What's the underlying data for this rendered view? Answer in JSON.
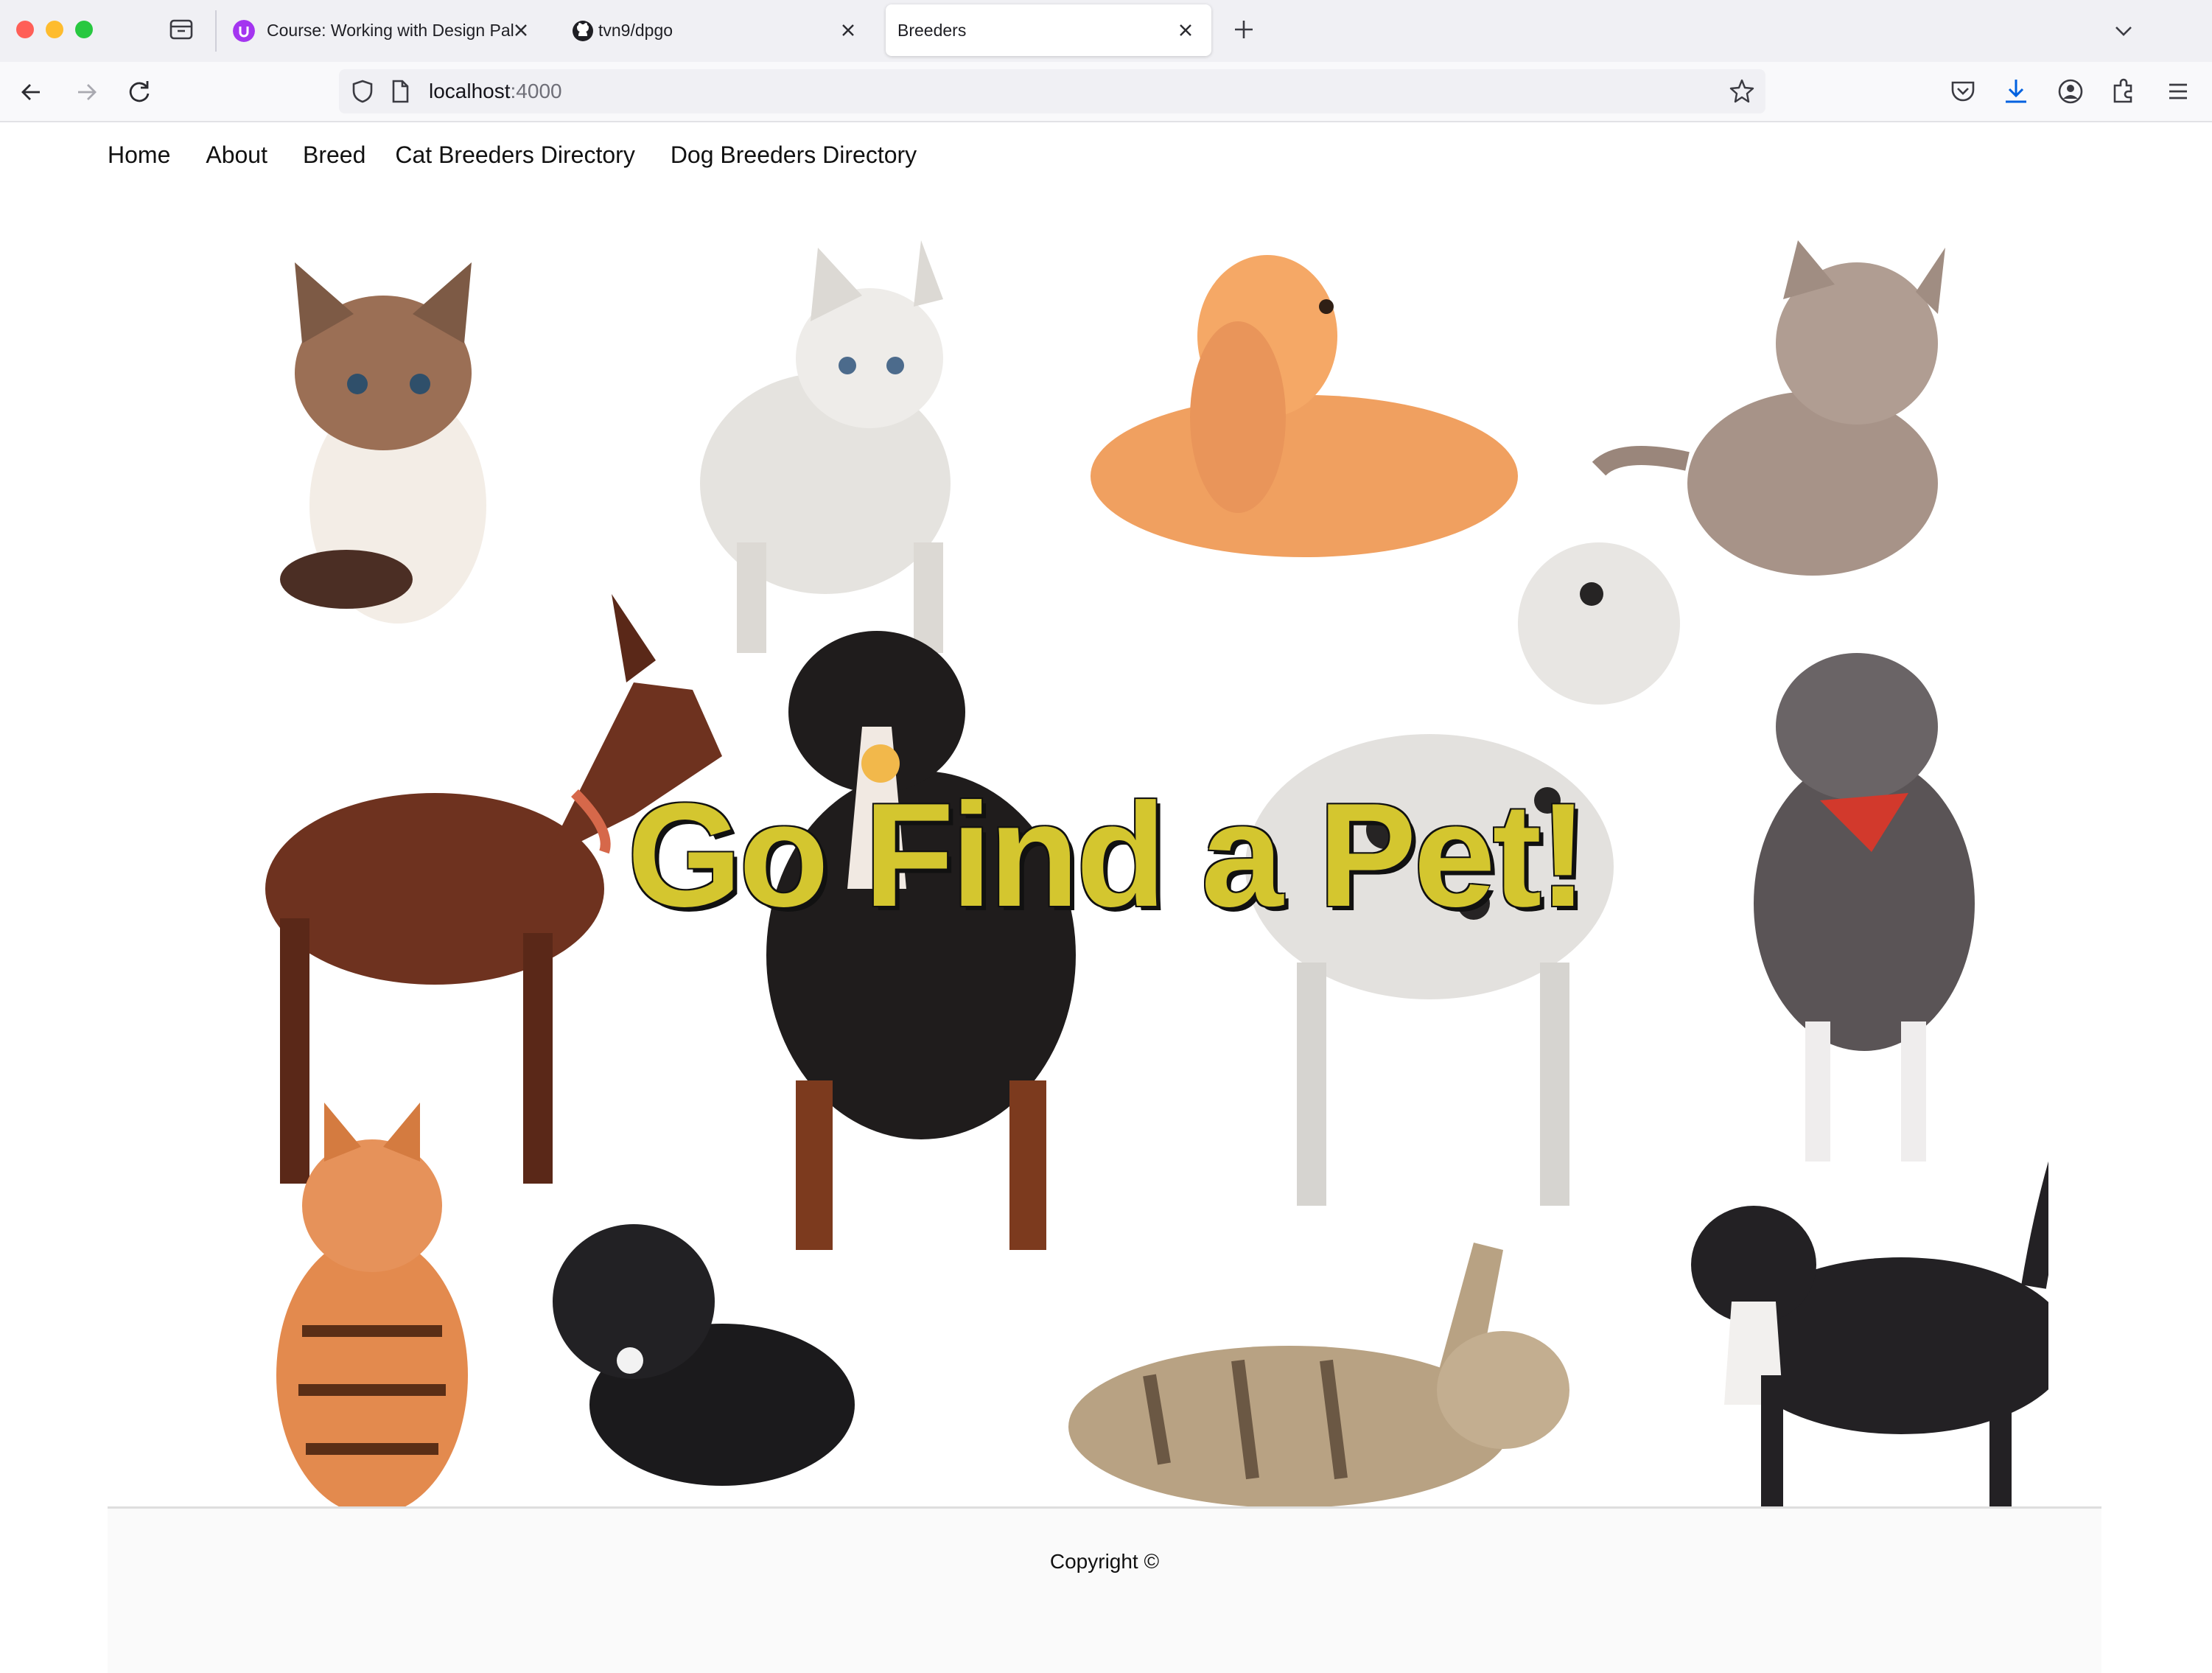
{
  "browser": {
    "tabs": [
      {
        "title": "Course: Working with Design Pal",
        "favicon": "udemy-icon",
        "active": false
      },
      {
        "title": "tvn9/dpgo",
        "favicon": "github-icon",
        "active": false
      },
      {
        "title": "Breeders",
        "favicon": "",
        "active": true
      }
    ],
    "url": {
      "host": "localhost",
      "port": ":4000"
    },
    "colors": {
      "chrome": "#f0f0f4",
      "accent_download": "#0061e0"
    }
  },
  "site": {
    "nav": [
      {
        "label": "Home"
      },
      {
        "label": "About"
      },
      {
        "label": "Breed"
      },
      {
        "label": "Cat Breeders Directory"
      },
      {
        "label": "Dog Breeders Directory"
      }
    ],
    "hero": {
      "title": "Go Find a Pet!",
      "title_color": "#d4c62f",
      "illustration": "cats-and-dogs-collage"
    },
    "footer": {
      "copyright": "Copyright ©"
    }
  }
}
